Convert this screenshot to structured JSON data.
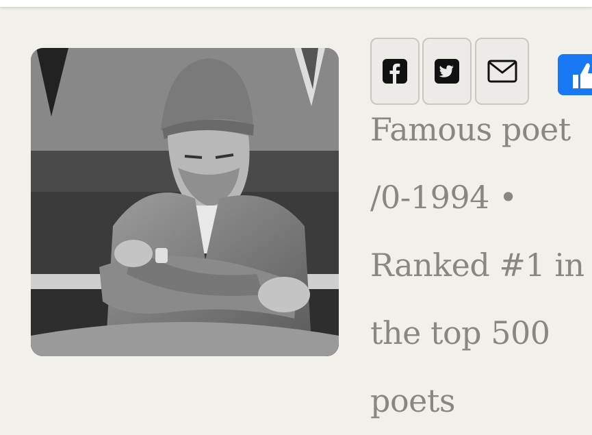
{
  "portrait": {
    "alt": "Black and white portrait of a man in a knit cap and corduroy jacket, arms crossed"
  },
  "share": {
    "items": [
      {
        "name": "facebook",
        "icon": "facebook-square-icon"
      },
      {
        "name": "twitter",
        "icon": "twitter-square-icon"
      },
      {
        "name": "email",
        "icon": "envelope-icon"
      }
    ],
    "like_icon": "thumbs-up-icon",
    "like_color": "#1877f2"
  },
  "info": {
    "lines": [
      "Famous poet",
      "/0-1994 •",
      "Ranked #1 in",
      "the top 500",
      "poets"
    ]
  },
  "colors": {
    "background": "#f2f0eb",
    "text": "#8a8782",
    "button_border": "#c9c7c2"
  }
}
